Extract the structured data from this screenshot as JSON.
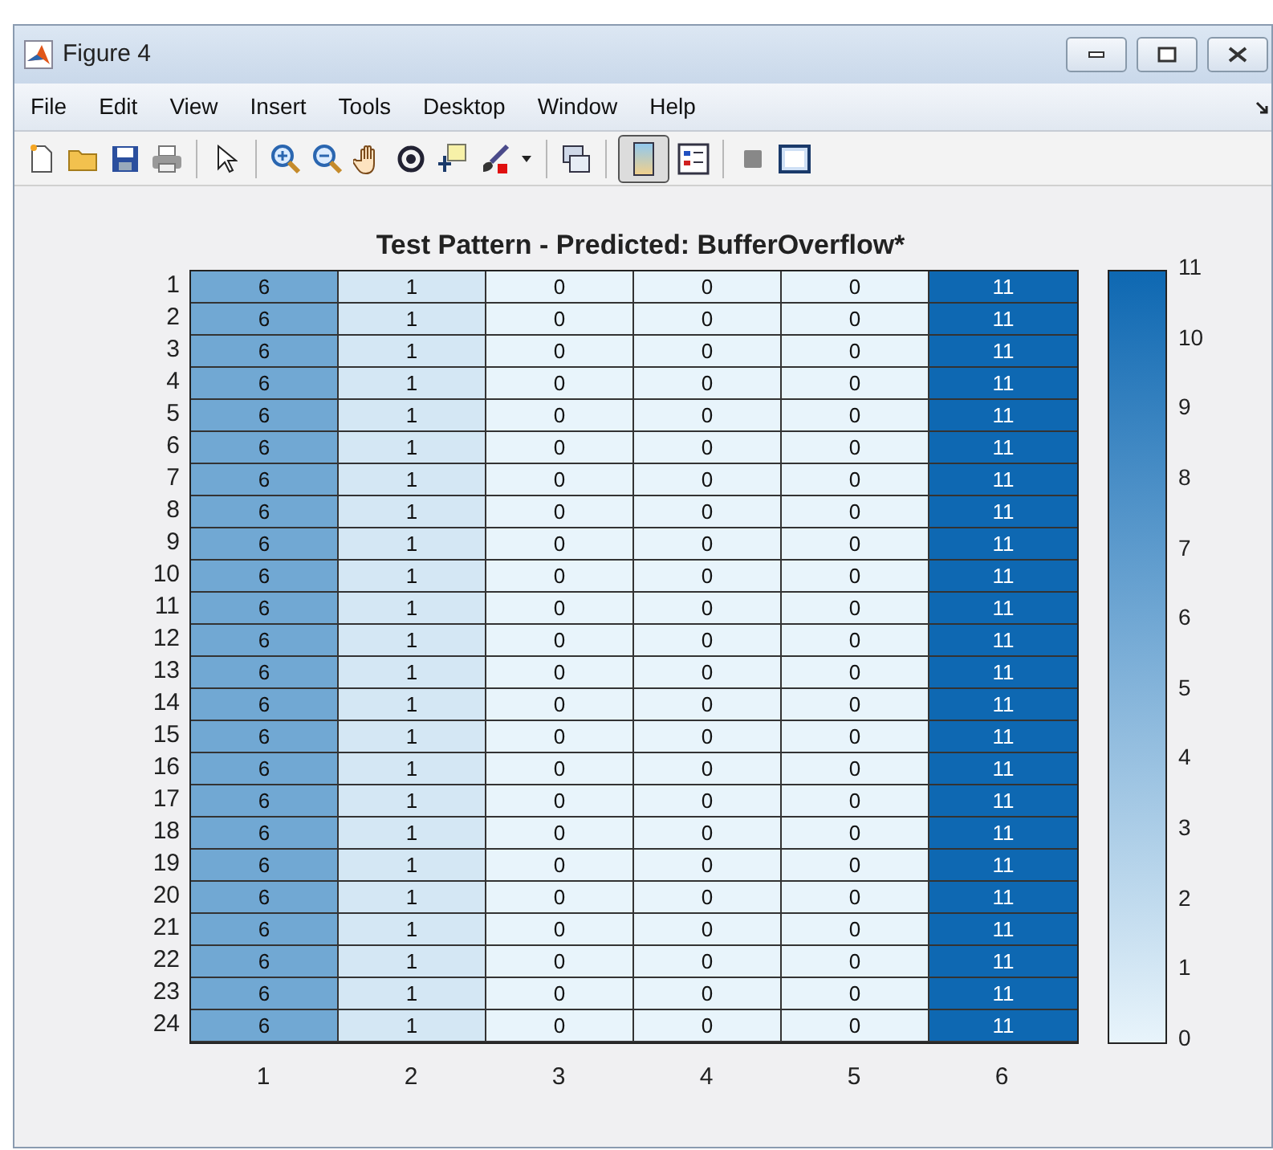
{
  "window": {
    "title": "Figure 4"
  },
  "menu": [
    "File",
    "Edit",
    "View",
    "Insert",
    "Tools",
    "Desktop",
    "Window",
    "Help"
  ],
  "toolbar": [
    {
      "kind": "new"
    },
    {
      "kind": "open"
    },
    {
      "kind": "save"
    },
    {
      "kind": "print"
    },
    {
      "kind": "sep"
    },
    {
      "kind": "pointer"
    },
    {
      "kind": "sep"
    },
    {
      "kind": "zoom-in"
    },
    {
      "kind": "zoom-out"
    },
    {
      "kind": "pan"
    },
    {
      "kind": "rotate"
    },
    {
      "kind": "datatip"
    },
    {
      "kind": "brush"
    },
    {
      "kind": "caret"
    },
    {
      "kind": "sep"
    },
    {
      "kind": "link"
    },
    {
      "kind": "sep"
    },
    {
      "kind": "colorbar",
      "selected": true
    },
    {
      "kind": "legend",
      "selected": false
    },
    {
      "kind": "sep"
    },
    {
      "kind": "square"
    },
    {
      "kind": "frame"
    }
  ],
  "heatmap": {
    "title": "Test Pattern - Predicted: BufferOverflow*",
    "x_tick_labels": [
      "1",
      "2",
      "3",
      "4",
      "5",
      "6"
    ],
    "rows": [
      {
        "label": "1",
        "cells": [
          "6",
          "1",
          "0",
          "0",
          "0",
          "11"
        ]
      },
      {
        "label": "2",
        "cells": [
          "6",
          "1",
          "0",
          "0",
          "0",
          "11"
        ]
      },
      {
        "label": "3",
        "cells": [
          "6",
          "1",
          "0",
          "0",
          "0",
          "11"
        ]
      },
      {
        "label": "4",
        "cells": [
          "6",
          "1",
          "0",
          "0",
          "0",
          "11"
        ]
      },
      {
        "label": "5",
        "cells": [
          "6",
          "1",
          "0",
          "0",
          "0",
          "11"
        ]
      },
      {
        "label": "6",
        "cells": [
          "6",
          "1",
          "0",
          "0",
          "0",
          "11"
        ]
      },
      {
        "label": "7",
        "cells": [
          "6",
          "1",
          "0",
          "0",
          "0",
          "11"
        ]
      },
      {
        "label": "8",
        "cells": [
          "6",
          "1",
          "0",
          "0",
          "0",
          "11"
        ]
      },
      {
        "label": "9",
        "cells": [
          "6",
          "1",
          "0",
          "0",
          "0",
          "11"
        ]
      },
      {
        "label": "10",
        "cells": [
          "6",
          "1",
          "0",
          "0",
          "0",
          "11"
        ]
      },
      {
        "label": "11",
        "cells": [
          "6",
          "1",
          "0",
          "0",
          "0",
          "11"
        ]
      },
      {
        "label": "12",
        "cells": [
          "6",
          "1",
          "0",
          "0",
          "0",
          "11"
        ]
      },
      {
        "label": "13",
        "cells": [
          "6",
          "1",
          "0",
          "0",
          "0",
          "11"
        ]
      },
      {
        "label": "14",
        "cells": [
          "6",
          "1",
          "0",
          "0",
          "0",
          "11"
        ]
      },
      {
        "label": "15",
        "cells": [
          "6",
          "1",
          "0",
          "0",
          "0",
          "11"
        ]
      },
      {
        "label": "16",
        "cells": [
          "6",
          "1",
          "0",
          "0",
          "0",
          "11"
        ]
      },
      {
        "label": "17",
        "cells": [
          "6",
          "1",
          "0",
          "0",
          "0",
          "11"
        ]
      },
      {
        "label": "18",
        "cells": [
          "6",
          "1",
          "0",
          "0",
          "0",
          "11"
        ]
      },
      {
        "label": "19",
        "cells": [
          "6",
          "1",
          "0",
          "0",
          "0",
          "11"
        ]
      },
      {
        "label": "20",
        "cells": [
          "6",
          "1",
          "0",
          "0",
          "0",
          "11"
        ]
      },
      {
        "label": "21",
        "cells": [
          "6",
          "1",
          "0",
          "0",
          "0",
          "11"
        ]
      },
      {
        "label": "22",
        "cells": [
          "6",
          "1",
          "0",
          "0",
          "0",
          "11"
        ]
      },
      {
        "label": "23",
        "cells": [
          "6",
          "1",
          "0",
          "0",
          "0",
          "11"
        ]
      },
      {
        "label": "24",
        "cells": [
          "6",
          "1",
          "0",
          "0",
          "0",
          "11"
        ]
      }
    ],
    "colorbar": {
      "ticks": [
        "11",
        "10",
        "9",
        "8",
        "7",
        "6",
        "5",
        "4",
        "3",
        "2",
        "1",
        "0"
      ]
    }
  }
}
